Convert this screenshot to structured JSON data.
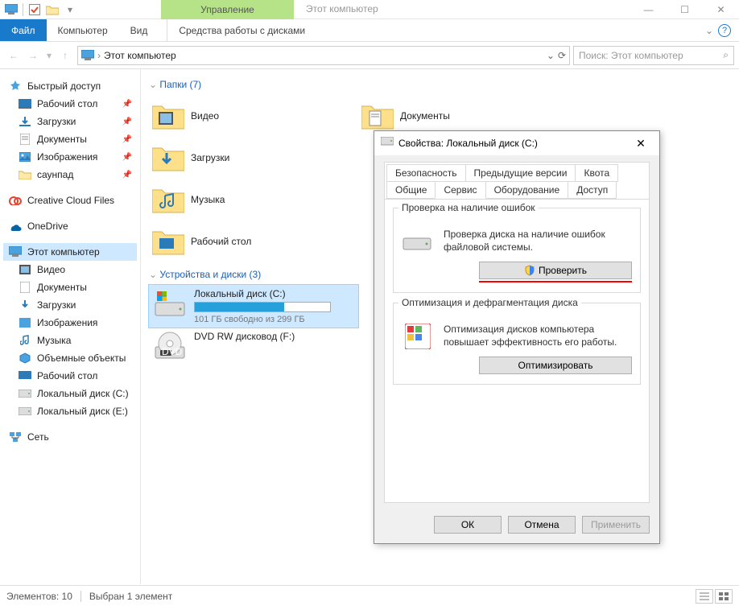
{
  "titlebar": {
    "contextual_tab": "Управление",
    "window_title": "Этот компьютер"
  },
  "ribbon": {
    "file": "Файл",
    "tabs": [
      "Компьютер",
      "Вид"
    ],
    "contextual": "Средства работы с дисками"
  },
  "address": {
    "crumb": "Этот компьютер"
  },
  "search": {
    "placeholder": "Поиск: Этот компьютер"
  },
  "nav": {
    "quick_access": "Быстрый доступ",
    "quick_items": [
      {
        "label": "Рабочий стол",
        "icon": "desktop"
      },
      {
        "label": "Загрузки",
        "icon": "downloads"
      },
      {
        "label": "Документы",
        "icon": "documents"
      },
      {
        "label": "Изображения",
        "icon": "pictures"
      },
      {
        "label": "саунпад",
        "icon": "folder"
      }
    ],
    "creative_cloud": "Creative Cloud Files",
    "onedrive": "OneDrive",
    "this_pc": "Этот компьютер",
    "pc_items": [
      {
        "label": "Видео",
        "icon": "videos"
      },
      {
        "label": "Документы",
        "icon": "documents"
      },
      {
        "label": "Загрузки",
        "icon": "downloads"
      },
      {
        "label": "Изображения",
        "icon": "pictures"
      },
      {
        "label": "Музыка",
        "icon": "music"
      },
      {
        "label": "Объемные объекты",
        "icon": "3d"
      },
      {
        "label": "Рабочий стол",
        "icon": "desktop"
      },
      {
        "label": "Локальный диск (C:)",
        "icon": "drive"
      },
      {
        "label": "Локальный диск (E:)",
        "icon": "drive"
      }
    ],
    "network": "Сеть"
  },
  "content": {
    "folders_header": "Папки (7)",
    "folders": [
      {
        "label": "Видео"
      },
      {
        "label": "Документы"
      },
      {
        "label": "Загрузки"
      },
      {
        "label": "Музыка"
      },
      {
        "label": "Рабочий стол"
      }
    ],
    "devices_header": "Устройства и диски (3)",
    "drive_c": {
      "label": "Локальный диск (C:)",
      "capacity_text": "101 ГБ свободно из 299 ГБ",
      "fill_percent": 66
    },
    "dvd": {
      "label": "DVD RW дисковод (F:)"
    }
  },
  "status": {
    "elements": "Элементов: 10",
    "selected": "Выбран 1 элемент"
  },
  "dialog": {
    "title": "Свойства: Локальный диск (C:)",
    "tabs_row1": [
      "Безопасность",
      "Предыдущие версии",
      "Квота"
    ],
    "tabs_row2": [
      "Общие",
      "Сервис",
      "Оборудование",
      "Доступ"
    ],
    "active_tab": "Сервис",
    "errcheck": {
      "legend": "Проверка на наличие ошибок",
      "text": "Проверка диска на наличие ошибок файловой системы.",
      "button": "Проверить"
    },
    "defrag": {
      "legend": "Оптимизация и дефрагментация диска",
      "text": "Оптимизация дисков компьютера повышает эффективность его работы.",
      "button": "Оптимизировать"
    },
    "footer": {
      "ok": "ОК",
      "cancel": "Отмена",
      "apply": "Применить"
    }
  }
}
